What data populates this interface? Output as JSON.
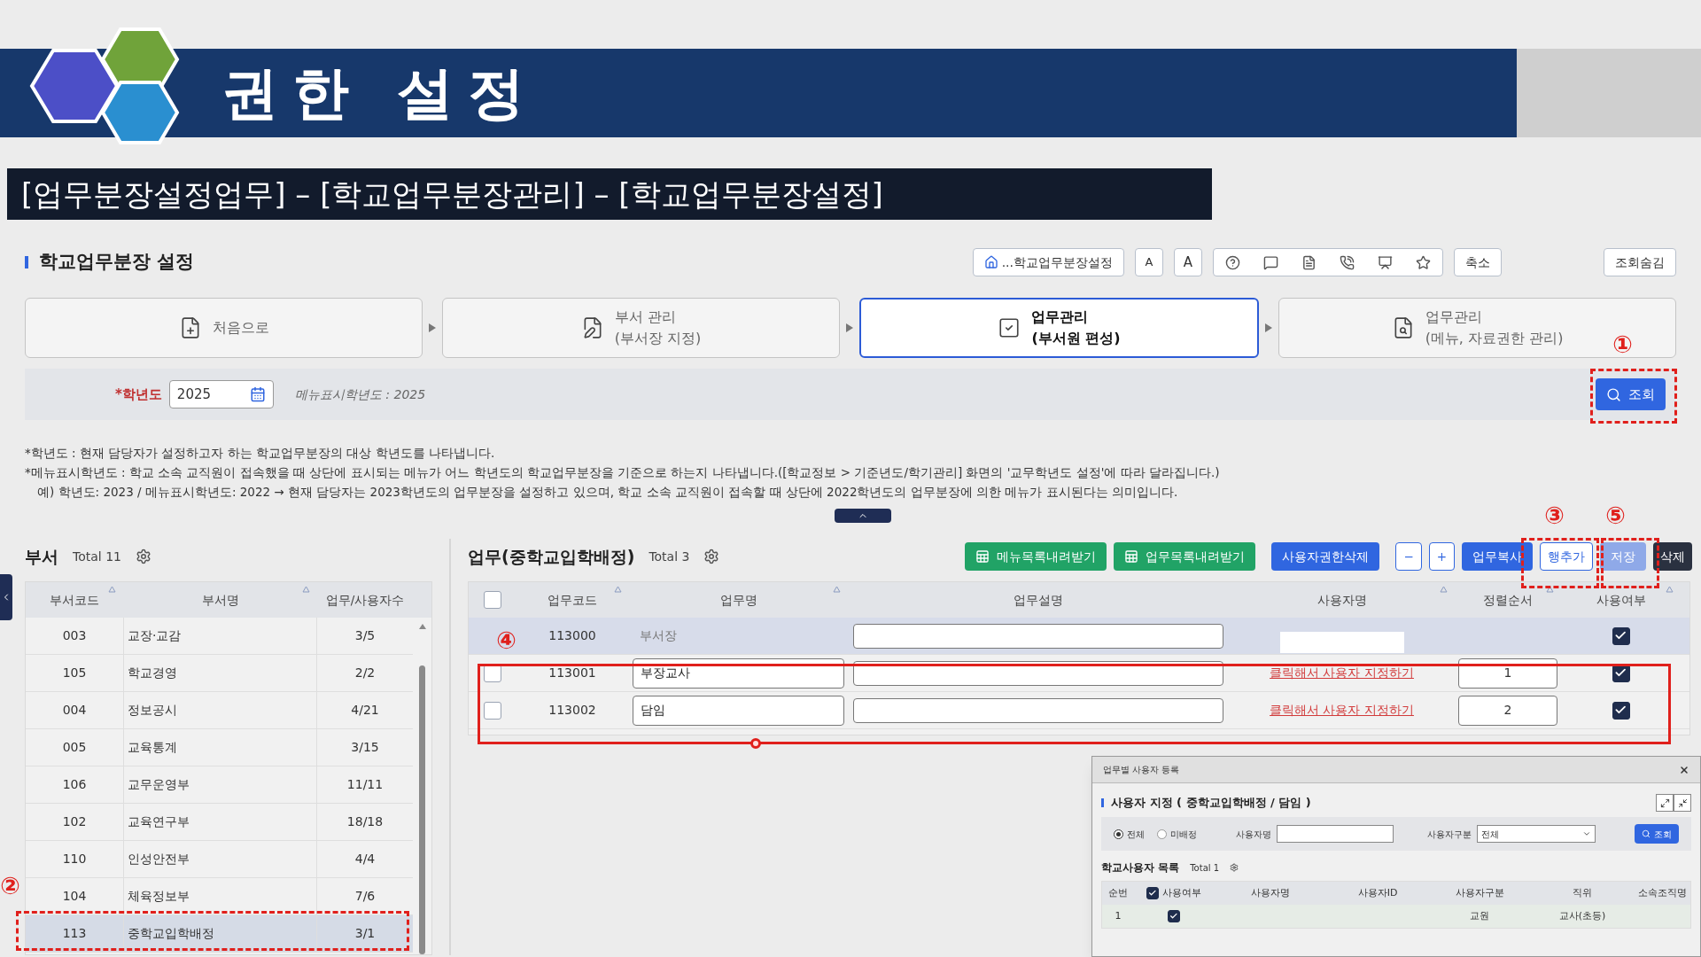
{
  "banner": {
    "title": "권한 설정"
  },
  "breadcrumb": "[업무분장설정업무] – [학교업무분장관리] – [학교업무분장설정]",
  "page_title": "학교업무분장 설정",
  "toolbar": {
    "location": "...학교업무분장설정",
    "font_buttons": [
      "A",
      "A"
    ],
    "shrink": "축소",
    "hide_search": "조회숨김"
  },
  "steps": [
    {
      "lines": [
        "처음으로"
      ],
      "selected": false
    },
    {
      "lines": [
        "부서 관리",
        "(부서장 지정)"
      ],
      "selected": false
    },
    {
      "lines": [
        "업무관리",
        "(부서원 편성)"
      ],
      "selected": true
    },
    {
      "lines": [
        "업무관리",
        "(메뉴, 자료권한 관리)"
      ],
      "selected": false
    }
  ],
  "search": {
    "year_label": "*학년도",
    "year_value": "2025",
    "menu_year": "메뉴표시학년도 : 2025",
    "button": "조회"
  },
  "notes": [
    "*학년도 : 현재 담당자가 설정하고자 하는 학교업무분장의 대상 학년도를 나타냅니다.",
    "*메뉴표시학년도 : 학교 소속 교직원이 접속했을 때 상단에 표시되는 메뉴가 어느 학년도의 학교업무분장을 기준으로 하는지 나타냅니다.([학교정보 > 기준년도/학기관리] 화면의 '교무학년도 설정'에 따라 달라집니다.)",
    "예) 학년도: 2023 / 메뉴표시학년도: 2022 → 현재 담당자는 2023학년도의 업무분장을 설정하고 있으며, 학교 소속 교직원이 접속할 때 상단에 2022학년도의 업무분장에 의한 메뉴가 표시된다는 의미입니다."
  ],
  "departments": {
    "title": "부서",
    "total": "Total 11",
    "columns": [
      "부서코드",
      "부서명",
      "업무/사용자수"
    ],
    "rows": [
      {
        "code": "003",
        "name": "교장·교감",
        "count": "3/5",
        "selected": false
      },
      {
        "code": "105",
        "name": "학교경영",
        "count": "2/2",
        "selected": false
      },
      {
        "code": "004",
        "name": "정보공시",
        "count": "4/21",
        "selected": false
      },
      {
        "code": "005",
        "name": "교육통계",
        "count": "3/15",
        "selected": false
      },
      {
        "code": "106",
        "name": "교무운영부",
        "count": "11/11",
        "selected": false
      },
      {
        "code": "102",
        "name": "교육연구부",
        "count": "18/18",
        "selected": false
      },
      {
        "code": "110",
        "name": "인성안전부",
        "count": "4/4",
        "selected": false
      },
      {
        "code": "104",
        "name": "체육정보부",
        "count": "7/6",
        "selected": false
      },
      {
        "code": "113",
        "name": "중학교입학배정",
        "count": "3/1",
        "selected": true
      }
    ]
  },
  "tasks": {
    "title": "업무(중학교입학배정)",
    "total": "Total 3",
    "buttons": [
      {
        "label": "메뉴목록내려받기",
        "kind": "excel"
      },
      {
        "label": "업무목록내려받기",
        "kind": "excel"
      },
      {
        "label": "사용자권한삭제",
        "kind": "primary"
      },
      {
        "label": "−",
        "kind": "outline"
      },
      {
        "label": "+",
        "kind": "outline"
      },
      {
        "label": "업무복사",
        "kind": "primary"
      },
      {
        "label": "행추가",
        "kind": "outline"
      },
      {
        "label": "저장",
        "kind": "light"
      },
      {
        "label": "삭제",
        "kind": "dark"
      }
    ],
    "header_checked": false,
    "columns": [
      "업무코드",
      "업무명",
      "업무설명",
      "사용자명",
      "정렬순서",
      "사용여부"
    ],
    "rows": [
      {
        "kind": "fixed",
        "selected": true,
        "code": "113000",
        "name": "부서장",
        "used": true
      },
      {
        "kind": "editable",
        "selected": false,
        "checked": false,
        "code": "113001",
        "name": "부장교사",
        "user_link": "클릭해서 사용자 지정하기",
        "order": "1",
        "used": true
      },
      {
        "kind": "editable",
        "selected": false,
        "checked": false,
        "code": "113002",
        "name": "담임",
        "user_link": "클릭해서 사용자 지정하기",
        "order": "2",
        "used": true
      }
    ]
  },
  "popup": {
    "title": "업무별 사용자 등록",
    "heading": "사용자 지정 ( 중학교입학배정 / 담임 )",
    "radios": [
      {
        "label": "전체",
        "selected": true
      },
      {
        "label": "미배정",
        "selected": false
      }
    ],
    "name_label": "사용자명",
    "type_label": "사용자구분",
    "type_value": "전체",
    "button": "조회",
    "list_title": "학교사용자 목록",
    "list_total": "Total 1",
    "columns": [
      "순번",
      "사용여부",
      "사용자명",
      "사용자ID",
      "사용자구분",
      "직위",
      "소속조직명"
    ],
    "header_checked": true,
    "rows": [
      {
        "index": "1",
        "checked": true,
        "type": "교원",
        "position": "교사(초등)"
      }
    ]
  },
  "annotations": [
    {
      "label": "①"
    },
    {
      "label": "②"
    },
    {
      "label": "③"
    },
    {
      "label": "⑤"
    },
    {
      "label": "④"
    }
  ]
}
